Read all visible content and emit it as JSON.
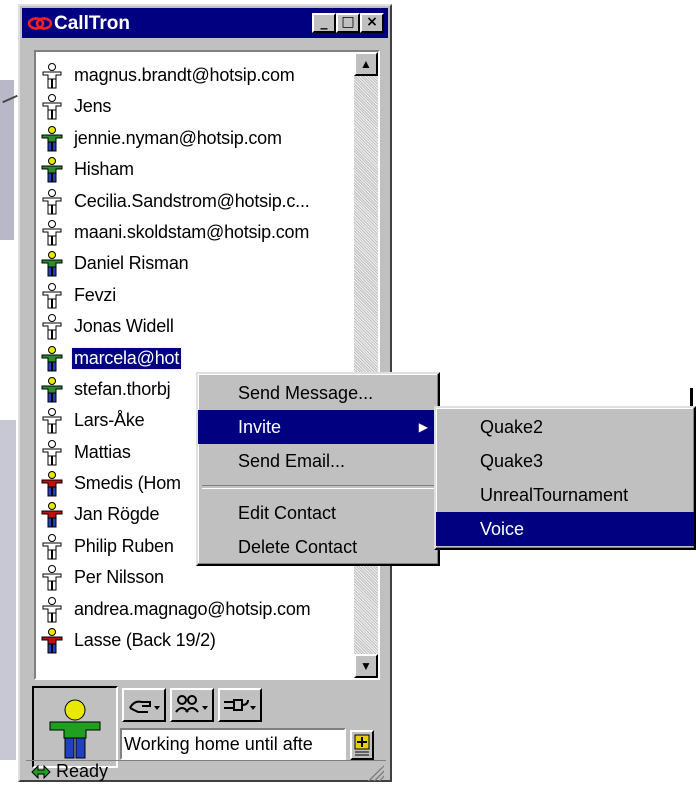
{
  "window": {
    "title": "CallTron",
    "controls": {
      "minimize": "_",
      "maximize": "□",
      "close": "×"
    }
  },
  "contacts": [
    {
      "name": "magnus.brandt@hotsip.com",
      "status": "offline"
    },
    {
      "name": "Jens",
      "status": "offline"
    },
    {
      "name": "jennie.nyman@hotsip.com",
      "status": "online"
    },
    {
      "name": "Hisham",
      "status": "online"
    },
    {
      "name": "Cecilia.Sandstrom@hotsip.c...",
      "status": "offline"
    },
    {
      "name": "maani.skoldstam@hotsip.com",
      "status": "offline"
    },
    {
      "name": "Daniel Risman",
      "status": "online"
    },
    {
      "name": "Fevzi",
      "status": "offline"
    },
    {
      "name": "Jonas Widell",
      "status": "offline"
    },
    {
      "name": "marcela@hot",
      "status": "online",
      "selected": true
    },
    {
      "name": "stefan.thorbj",
      "status": "online"
    },
    {
      "name": "Lars-Åke",
      "status": "offline"
    },
    {
      "name": "Mattias",
      "status": "offline"
    },
    {
      "name": "Smedis (Hom",
      "status": "busy"
    },
    {
      "name": "Jan Rögde",
      "status": "busy"
    },
    {
      "name": "Philip Ruben",
      "status": "offline"
    },
    {
      "name": "Per Nilsson",
      "status": "offline"
    },
    {
      "name": "andrea.magnago@hotsip.com",
      "status": "offline"
    },
    {
      "name": "Lasse (Back 19/2)",
      "status": "busy"
    }
  ],
  "context_menu": {
    "items": [
      "Send Message...",
      "Invite",
      "Send Email...",
      "Edit Contact",
      "Delete Contact"
    ],
    "highlighted": "Invite"
  },
  "invite_submenu": {
    "items": [
      "Quake2",
      "Quake3",
      "UnrealTournament",
      "Voice"
    ],
    "highlighted": "Voice"
  },
  "presence": {
    "status_message": "Working home until afte"
  },
  "statusbar": {
    "text": "Ready"
  },
  "colors": {
    "titlebar": "#000080",
    "online": "#2e8b2e",
    "busy": "#c01010",
    "offline": "#ffffff",
    "highlight": "#000080"
  },
  "icons": {
    "contact_status": "person-icon",
    "send": "hand-icon",
    "group": "people-icon",
    "connect": "plug-icon",
    "add": "plus-icon",
    "status": "double-arrow-icon"
  }
}
